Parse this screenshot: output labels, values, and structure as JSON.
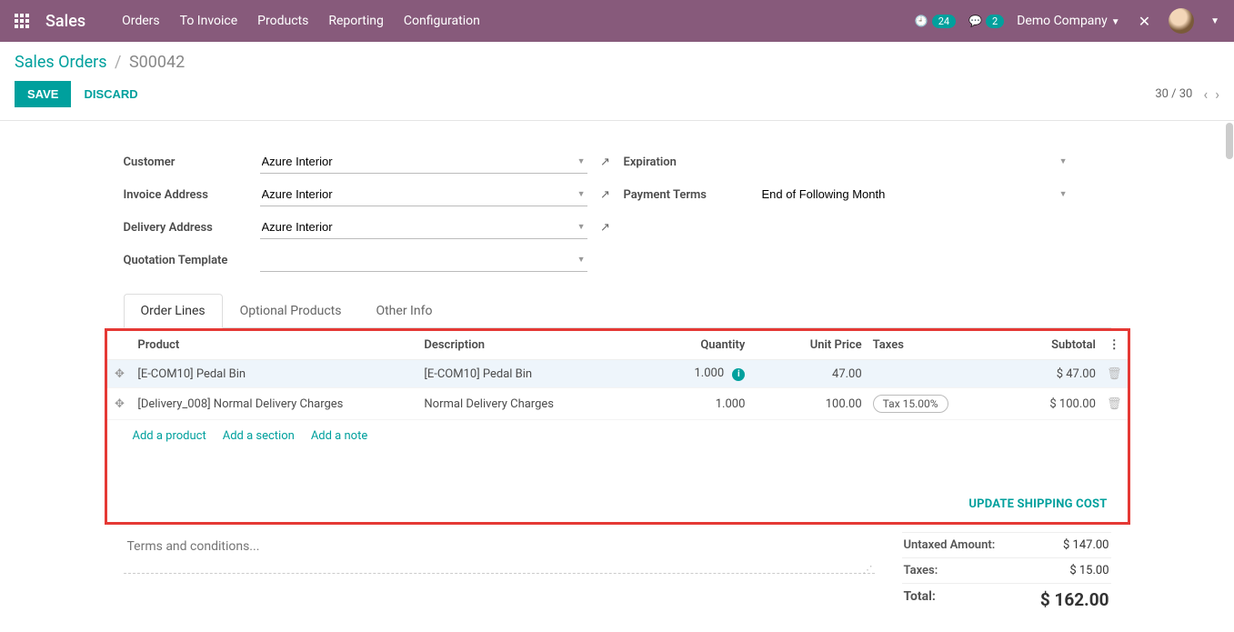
{
  "navbar": {
    "brand": "Sales",
    "items": [
      "Orders",
      "To Invoice",
      "Products",
      "Reporting",
      "Configuration"
    ],
    "clock_badge": "24",
    "chat_badge": "2",
    "company": "Demo Company"
  },
  "breadcrumb": {
    "root": "Sales Orders",
    "current": "S00042"
  },
  "actions": {
    "save": "SAVE",
    "discard": "DISCARD",
    "pager": "30 / 30"
  },
  "form": {
    "customer_label": "Customer",
    "customer_value": "Azure Interior",
    "invoice_label": "Invoice Address",
    "invoice_value": "Azure Interior",
    "delivery_label": "Delivery Address",
    "delivery_value": "Azure Interior",
    "template_label": "Quotation Template",
    "template_value": "",
    "expiration_label": "Expiration",
    "expiration_value": "",
    "terms_label": "Payment Terms",
    "terms_value": "End of Following Month"
  },
  "tabs": [
    "Order Lines",
    "Optional Products",
    "Other Info"
  ],
  "columns": {
    "product": "Product",
    "description": "Description",
    "quantity": "Quantity",
    "unit_price": "Unit Price",
    "taxes": "Taxes",
    "subtotal": "Subtotal"
  },
  "lines": [
    {
      "product": "[E-COM10] Pedal Bin",
      "description": "[E-COM10] Pedal Bin",
      "qty": "1.000",
      "info": true,
      "price": "47.00",
      "tax": "",
      "subtotal": "$ 47.00"
    },
    {
      "product": "[Delivery_008] Normal Delivery Charges",
      "description": "Normal Delivery Charges",
      "qty": "1.000",
      "info": false,
      "price": "100.00",
      "tax": "Tax 15.00%",
      "subtotal": "$ 100.00"
    }
  ],
  "add_links": {
    "product": "Add a product",
    "section": "Add a section",
    "note": "Add a note"
  },
  "update_shipping": "UPDATE SHIPPING COST",
  "terms_placeholder": "Terms and conditions...",
  "totals": {
    "untaxed_label": "Untaxed Amount:",
    "untaxed_value": "$ 147.00",
    "taxes_label": "Taxes:",
    "taxes_value": "$ 15.00",
    "total_label": "Total:",
    "total_value": "$ 162.00"
  }
}
